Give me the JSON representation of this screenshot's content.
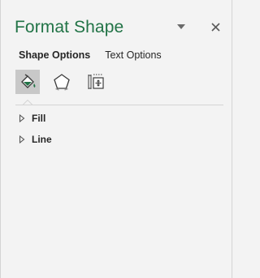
{
  "pane": {
    "title": "Format Shape",
    "header_icons": {
      "dropdown": "chevron-down-icon",
      "close": "close-icon"
    }
  },
  "tabs": [
    {
      "label": "Shape Options",
      "active": true
    },
    {
      "label": "Text Options",
      "active": false
    }
  ],
  "icon_tabs": [
    {
      "name": "fill-line-icon",
      "selected": true
    },
    {
      "name": "effects-icon",
      "selected": false
    },
    {
      "name": "size-properties-icon",
      "selected": false
    }
  ],
  "sections": [
    {
      "label": "Fill",
      "expanded": false
    },
    {
      "label": "Line",
      "expanded": false
    }
  ],
  "colors": {
    "title": "#217346",
    "background": "#f3f3f3",
    "selected_icon_bg": "#c8c8c8"
  }
}
